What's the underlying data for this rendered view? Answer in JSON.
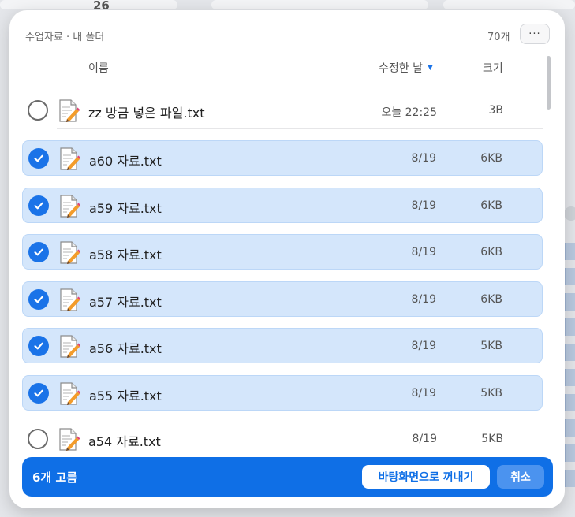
{
  "background": {
    "date_number": "26"
  },
  "header": {
    "breadcrumb": "수업자료 · 내 폴더",
    "item_count": "70개",
    "more_label": "···"
  },
  "columns": {
    "name": "이름",
    "modified": "수정한 날",
    "size": "크기"
  },
  "files": [
    {
      "name": "zz 방금 넣은 파일.txt",
      "modified": "오늘 22:25",
      "size": "3B",
      "selected": false
    },
    {
      "name": "a60 자료.txt",
      "modified": "8/19",
      "size": "6KB",
      "selected": true
    },
    {
      "name": "a59 자료.txt",
      "modified": "8/19",
      "size": "6KB",
      "selected": true
    },
    {
      "name": "a58 자료.txt",
      "modified": "8/19",
      "size": "6KB",
      "selected": true
    },
    {
      "name": "a57 자료.txt",
      "modified": "8/19",
      "size": "6KB",
      "selected": true
    },
    {
      "name": "a56 자료.txt",
      "modified": "8/19",
      "size": "5KB",
      "selected": true
    },
    {
      "name": "a55 자료.txt",
      "modified": "8/19",
      "size": "5KB",
      "selected": true
    },
    {
      "name": "a54 자료.txt",
      "modified": "8/19",
      "size": "5KB",
      "selected": false
    }
  ],
  "footer": {
    "selection_label": "6개 고름",
    "export_label": "바탕화면으로 꺼내기",
    "cancel_label": "취소"
  },
  "colors": {
    "accent": "#0f6fe6",
    "selected_row": "#d4e6fb",
    "check": "#1a73e8"
  },
  "icons": {
    "file": "text-file-pencil-icon",
    "check": "check-icon",
    "sort": "sort-down-icon"
  }
}
